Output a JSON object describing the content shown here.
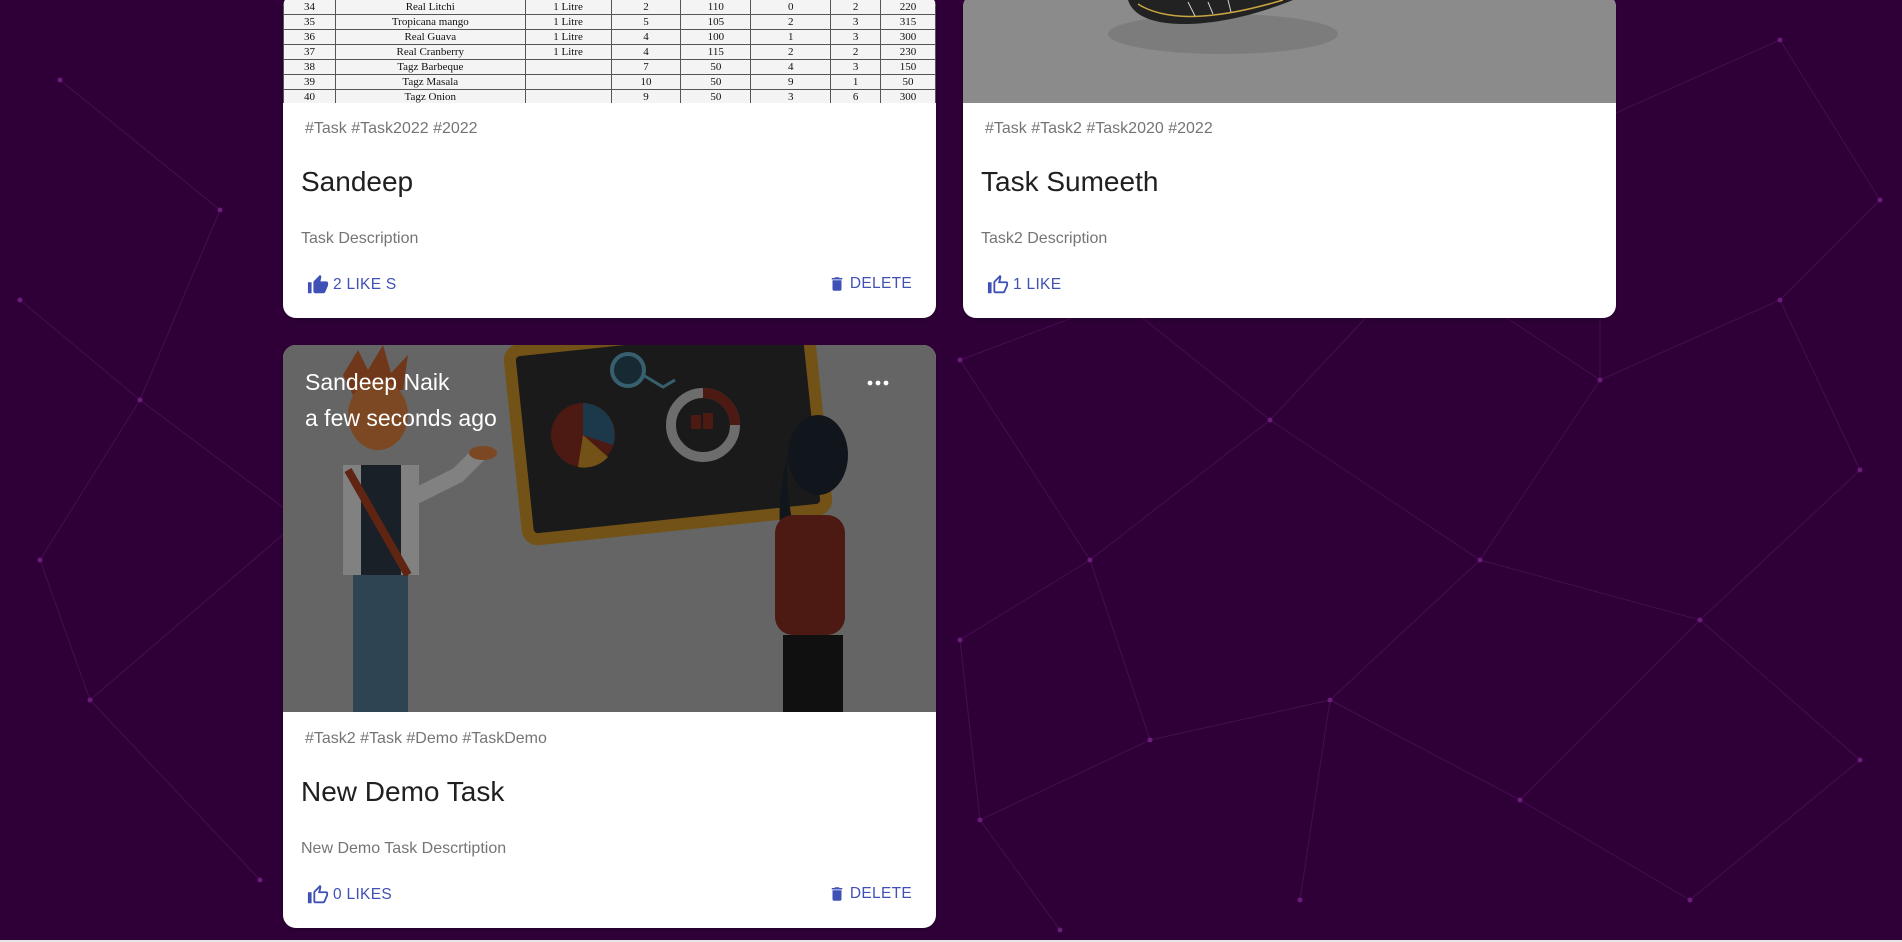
{
  "cards": [
    {
      "tags": "#Task #Task2022 #2022",
      "title": "Sandeep",
      "description": "Task Description",
      "like_label": "2 LIKE S",
      "delete_label": "DELETE",
      "image": {
        "icon": "spreadsheet-photo",
        "rows": [
          [
            "34",
            "Real Litchi",
            "1 Litre",
            "2",
            "110",
            "0",
            "2",
            "220"
          ],
          [
            "35",
            "Tropicana mango",
            "1 Litre",
            "5",
            "105",
            "2",
            "3",
            "315"
          ],
          [
            "36",
            "Real Guava",
            "1 Litre",
            "4",
            "100",
            "1",
            "3",
            "300"
          ],
          [
            "37",
            "Real Cranberry",
            "1 Litre",
            "4",
            "115",
            "2",
            "2",
            "230"
          ],
          [
            "38",
            "Tagz Barbeque",
            "",
            "7",
            "50",
            "4",
            "3",
            "150"
          ],
          [
            "39",
            "Tagz Masala",
            "",
            "10",
            "50",
            "9",
            "1",
            "50"
          ],
          [
            "40",
            "Tagz Onion",
            "",
            "9",
            "50",
            "3",
            "6",
            "300"
          ]
        ]
      }
    },
    {
      "tags": "#Task #Task2 #Task2020 #2022",
      "title": "Task Sumeeth",
      "description": "Task2 Description",
      "like_label": "1 LIKE",
      "image": {
        "icon": "shoe-photo"
      }
    },
    {
      "author": "Sandeep Naik",
      "time": "a few seconds ago",
      "tags": "#Task2 #Task #Demo #TaskDemo",
      "title": "New Demo Task",
      "description": "New Demo Task Descrtiption",
      "like_label": "0 LIKES",
      "delete_label": "DELETE",
      "image": {
        "icon": "presentation-illustration"
      }
    }
  ],
  "colors": {
    "background": "#2f0038",
    "accent": "#3f51b5",
    "card": "#ffffff",
    "muted_text": "#757575"
  },
  "icons": {
    "like_filled": "thumb-up-icon",
    "like_outline": "thumb-up-outline-icon",
    "delete": "trash-icon",
    "more": "more-horiz-icon"
  }
}
